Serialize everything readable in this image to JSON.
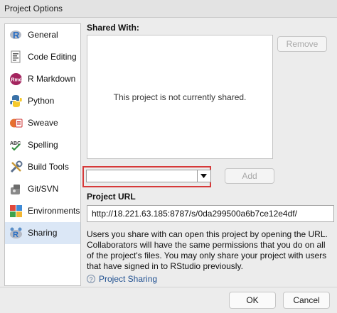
{
  "window": {
    "title": "Project Options"
  },
  "sidebar": {
    "items": [
      {
        "label": "General",
        "icon": "r-logo-icon"
      },
      {
        "label": "Code Editing",
        "icon": "code-editing-icon"
      },
      {
        "label": "R Markdown",
        "icon": "r-markdown-icon"
      },
      {
        "label": "Python",
        "icon": "python-icon"
      },
      {
        "label": "Sweave",
        "icon": "sweave-icon"
      },
      {
        "label": "Spelling",
        "icon": "spelling-icon"
      },
      {
        "label": "Build Tools",
        "icon": "build-tools-icon"
      },
      {
        "label": "Git/SVN",
        "icon": "git-svn-icon"
      },
      {
        "label": "Environments",
        "icon": "environments-icon"
      },
      {
        "label": "Sharing",
        "icon": "sharing-icon",
        "selected": true
      }
    ],
    "rmd_badge": "Rmd",
    "spelling_badge": "ABC"
  },
  "sharing": {
    "shared_with_label": "Shared With:",
    "empty_message": "This project is not currently shared.",
    "remove_label": "Remove",
    "user_select_value": "",
    "add_label": "Add",
    "project_url_label": "Project URL",
    "project_url": "http://18.221.63.185:8787/s/0da299500a6b7ce12e4df/",
    "description": "Users you share with can open this project by opening the URL. Collaborators will have the same permissions that you do on all of the project's files. You may only share your project with users that have signed in to RStudio previously.",
    "help_icon_glyph": "?",
    "help_link": "Project Sharing"
  },
  "footer": {
    "ok_label": "OK",
    "cancel_label": "Cancel"
  },
  "colors": {
    "selection": "#dbe7f6",
    "highlight": "#d63a3a",
    "link": "#1e4f90"
  }
}
